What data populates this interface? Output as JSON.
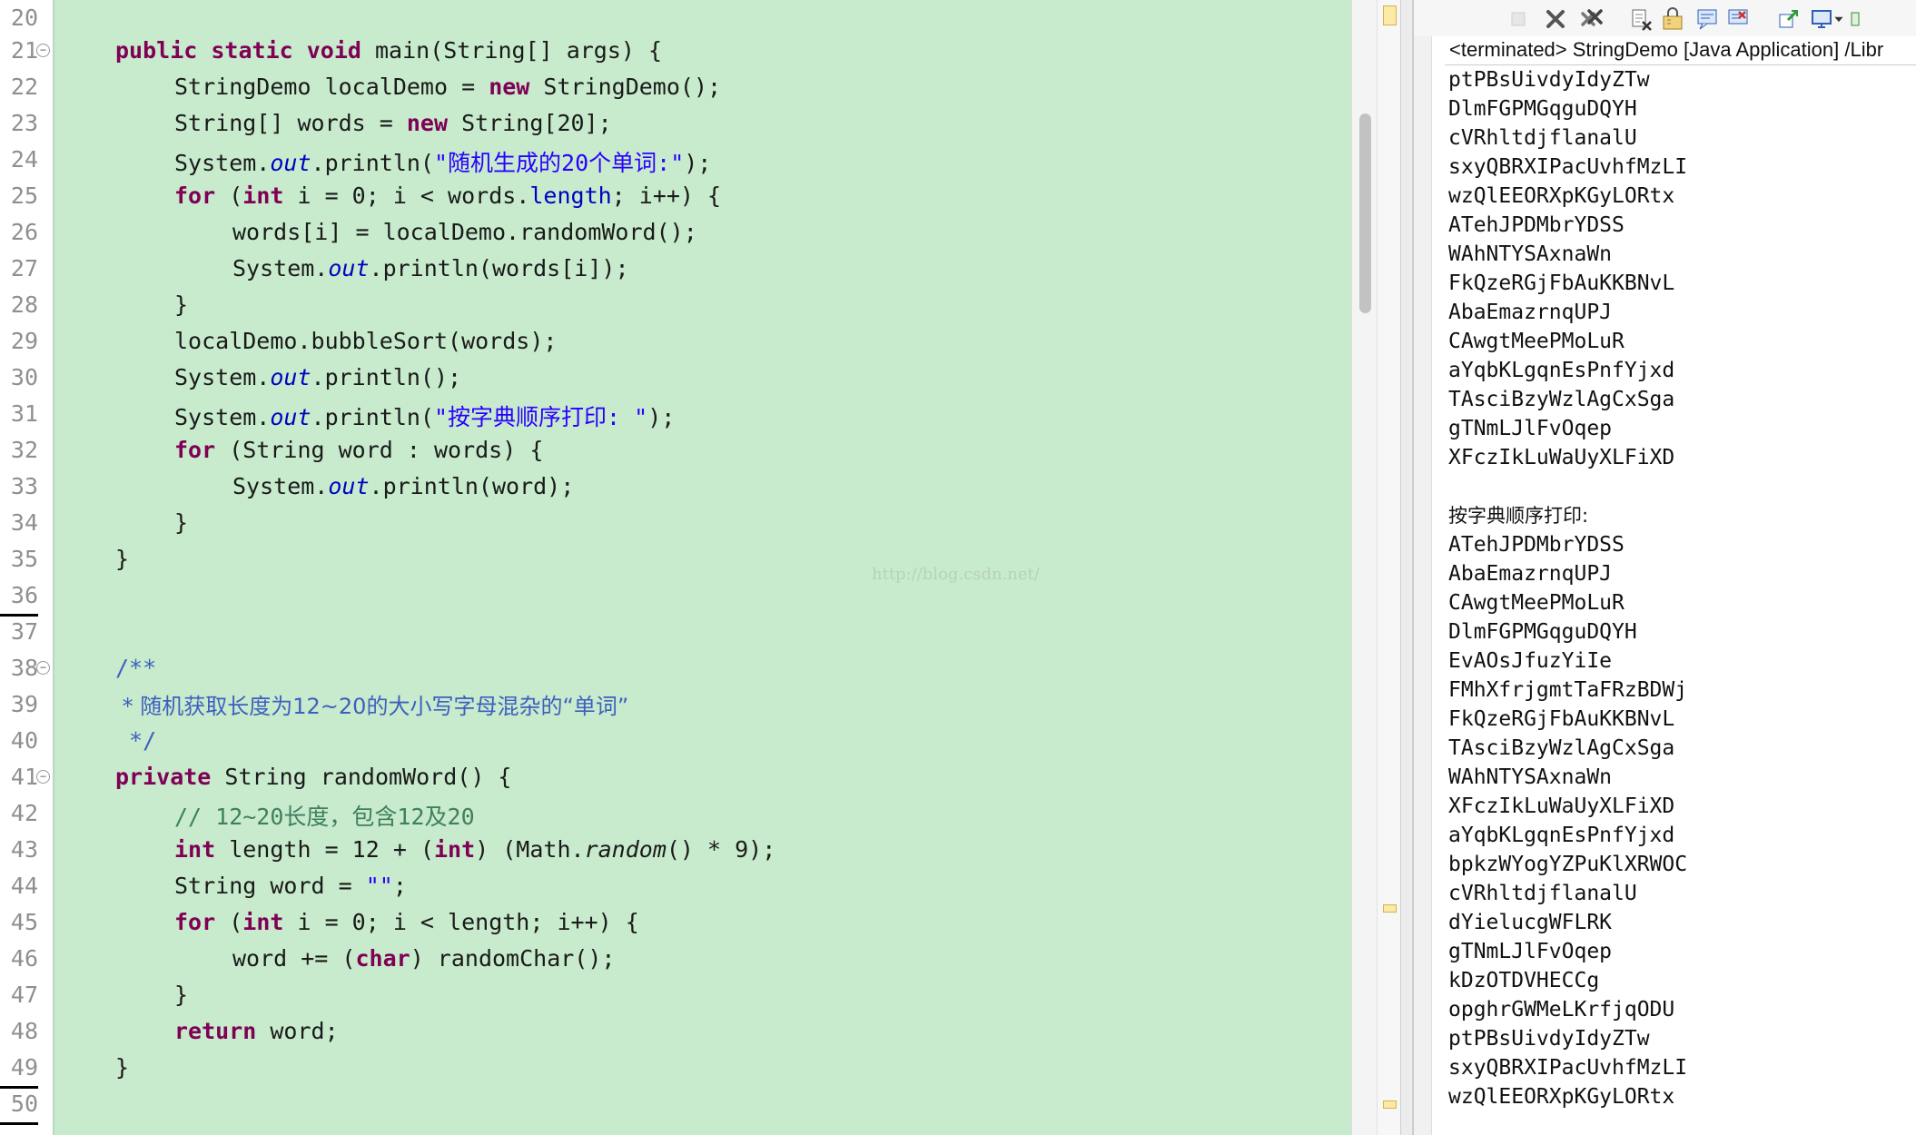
{
  "editor": {
    "watermark": "http://blog.csdn.net/",
    "line_numbers": [
      "20",
      "21",
      "22",
      "23",
      "24",
      "25",
      "26",
      "27",
      "28",
      "29",
      "30",
      "31",
      "32",
      "33",
      "34",
      "35",
      "36",
      "37",
      "38",
      "39",
      "40",
      "41",
      "42",
      "43",
      "44",
      "45",
      "46",
      "47",
      "48",
      "49",
      "50"
    ],
    "tokens": {
      "t21a": "public static void",
      "t21b": " main(String[] args) {",
      "t22a": "StringDemo localDemo = ",
      "t22b": "new",
      "t22c": " StringDemo();",
      "t23a": "String[] words = ",
      "t23b": "new",
      "t23c": " String[20];",
      "t24a": "System.",
      "t24b": "out",
      "t24c": ".println(",
      "t24d": "\"随机生成的20个单词:\"",
      "t24e": ");",
      "t25a": "for",
      "t25b": " (",
      "t25c": "int",
      "t25d": " i = 0; i < words.",
      "t25e": "length",
      "t25f": "; i++) {",
      "t26": "words[i] = localDemo.randomWord();",
      "t27a": "System.",
      "t27b": "out",
      "t27c": ".println(words[i]);",
      "t28": "}",
      "t29": "localDemo.bubbleSort(words);",
      "t30a": "System.",
      "t30b": "out",
      "t30c": ".println();",
      "t31a": "System.",
      "t31b": "out",
      "t31c": ".println(",
      "t31d": "\"按字典顺序打印: \"",
      "t31e": ");",
      "t32a": "for",
      "t32b": " (String word : words) {",
      "t33a": "System.",
      "t33b": "out",
      "t33c": ".println(word);",
      "t34": "}",
      "t35": "}",
      "t38": "/**",
      "t39": " * 随机获取长度为12~20的大小写字母混杂的“单词”",
      "t40": " */",
      "t41a": "private",
      "t41b": " String randomWord() {",
      "t42": "// 12~20长度，包含12及20",
      "t43a": "int",
      "t43b": " length = 12 + (",
      "t43c": "int",
      "t43d": ") (Math.",
      "t43e": "random",
      "t43f": "() * 9);",
      "t44a": "String word = ",
      "t44b": "\"\"",
      "t44c": ";",
      "t45a": "for",
      "t45b": " (",
      "t45c": "int",
      "t45d": " i = 0; i < length; i++) {",
      "t46a": "word += (",
      "t46b": "char",
      "t46c": ") randomChar();",
      "t47": "}",
      "t48a": "return",
      "t48b": " word;",
      "t49": "}"
    }
  },
  "console": {
    "title": "<terminated> StringDemo [Java Application] /Libr",
    "toolbar_icons": [
      "terminate-icon",
      "remove-launch-icon",
      "remove-all-terminated-icon",
      "clear-console-icon",
      "scroll-lock-icon",
      "show-on-stdout-icon",
      "show-on-stderr-icon",
      "pin-console-icon",
      "display-selected-console-icon",
      "view-menu-icon"
    ],
    "output": [
      "ptPBsUivdyIdyZTw",
      "DlmFGPMGqguDQYH",
      "cVRhltdjflanalU",
      "sxyQBRXIPacUvhfMzLI",
      "wzQlEEORXpKGyLORtx",
      "ATehJPDMbrYDSS",
      "WAhNTYSAxnaWn",
      "FkQzeRGjFbAuKKBNvL",
      "AbaEmazrnqUPJ",
      "CAwgtMeePMoLuR",
      "aYqbKLgqnEsPnfYjxd",
      "TAsciBzyWzlAgCxSga",
      "gTNmLJlFvOqep",
      "XFczIkLuWaUyXLFiXD",
      "",
      "按字典顺序打印:",
      "ATehJPDMbrYDSS",
      "AbaEmazrnqUPJ",
      "CAwgtMeePMoLuR",
      "DlmFGPMGqguDQYH",
      "EvAOsJfuzYiIe",
      "FMhXfrjgmtTaFRzBDWj",
      "FkQzeRGjFbAuKKBNvL",
      "TAsciBzyWzlAgCxSga",
      "WAhNTYSAxnaWn",
      "XFczIkLuWaUyXLFiXD",
      "aYqbKLgqnEsPnfYjxd",
      "bpkzWYogYZPuKlXRWOC",
      "cVRhltdjflanalU",
      "dYielucgWFLRK",
      "gTNmLJlFvOqep",
      "kDzOTDVHECCg",
      "opghrGWMeLKrfjqODU",
      "ptPBsUivdyIdyZTw",
      "sxyQBRXIPacUvhfMzLI",
      "wzQlEEORXpKGyLORtx"
    ]
  }
}
